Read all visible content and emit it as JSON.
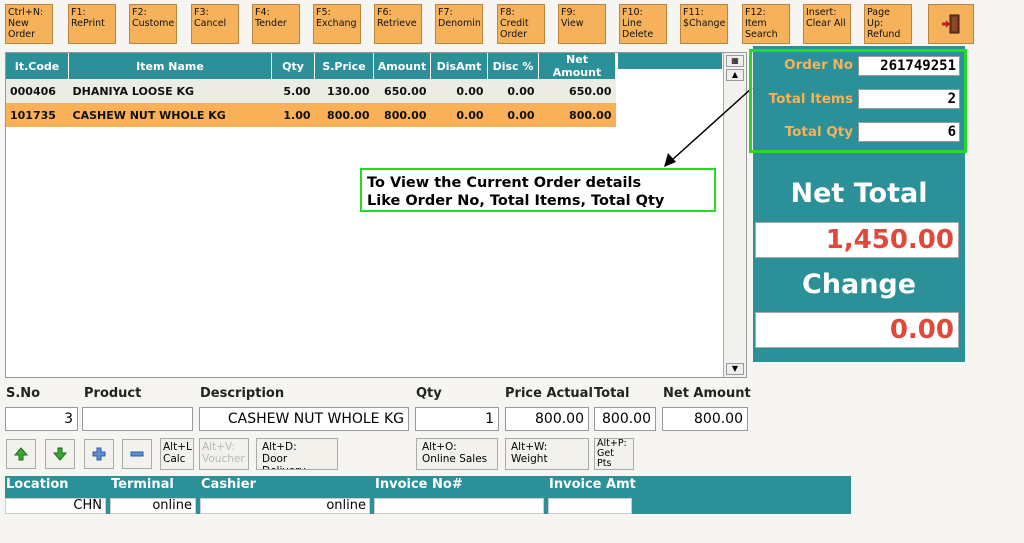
{
  "toolbar": [
    {
      "label": "Ctrl+N:\nNew\nOrder"
    },
    {
      "label": "F1:\nRePrint"
    },
    {
      "label": "F2:\nCustome"
    },
    {
      "label": "F3:\nCancel"
    },
    {
      "label": "F4:\nTender"
    },
    {
      "label": "F5:\nExchang"
    },
    {
      "label": "F6:\nRetrieve"
    },
    {
      "label": "F7:\nDenomin"
    },
    {
      "label": "F8:\nCredit\nOrder"
    },
    {
      "label": "F9:\nView"
    },
    {
      "label": "F10:\nLine\nDelete"
    },
    {
      "label": "F11:\n$Change"
    },
    {
      "label": "F12:\nItem\nSearch"
    },
    {
      "label": "Insert:\nClear All"
    },
    {
      "label": "Page\nUp:\nRefund"
    }
  ],
  "grid": {
    "headers": [
      "It.Code",
      "Item Name",
      "Qty",
      "S.Price",
      "Amount",
      "DisAmt",
      "Disc %",
      "Net Amount"
    ],
    "rows": [
      [
        "000406",
        "DHANIYA LOOSE KG",
        "5.00",
        "130.00",
        "650.00",
        "0.00",
        "0.00",
        "650.00"
      ],
      [
        "101735",
        "CASHEW NUT WHOLE KG",
        "1.00",
        "800.00",
        "800.00",
        "0.00",
        "0.00",
        "800.00"
      ]
    ]
  },
  "callout": {
    "line1": "To View the Current Order details",
    "line2": "Like Order No, Total Items, Total Qty"
  },
  "summary": {
    "order_no_label": "Order No",
    "order_no": "261749251",
    "total_items_label": "Total Items",
    "total_items": "2",
    "total_qty_label": "Total Qty",
    "total_qty": "6",
    "net_total_label": "Net Total",
    "net_total": "1,450.00",
    "change_label": "Change",
    "change": "0.00"
  },
  "entry": {
    "sno_label": "S.No",
    "product_label": "Product",
    "description_label": "Description",
    "qty_label": "Qty",
    "price_label": "Price Actual",
    "total_label": "Total",
    "net_amount_label": "Net Amount",
    "sno": "3",
    "product": "",
    "description": "CASHEW NUT WHOLE KG",
    "qty": "1",
    "price": "800.00",
    "total": "800.00",
    "net_amount": "800.00"
  },
  "shortcuts": {
    "calc": "Alt+L:\nCalc",
    "voucher": "Alt+V:\nVoucher",
    "door_delivery": "Alt+D:\nDoor Delivery",
    "online_sales": "Alt+O:\nOnline Sales",
    "weight": "Alt+W:\nWeight",
    "get_pts": "Alt+P:\nGet\nPts"
  },
  "status": {
    "location_label": "Location",
    "terminal_label": "Terminal",
    "cashier_label": "Cashier",
    "invoice_no_label": "Invoice No#",
    "invoice_amt_label": "Invoice Amt",
    "location": "CHN",
    "terminal": "online",
    "cashier": "online",
    "invoice_no": "",
    "invoice_amt": ""
  },
  "colors": {
    "teal": "#2b9097",
    "orange": "#f6b25a",
    "highlight_green": "#26d926",
    "amount_red": "#e0493a"
  }
}
